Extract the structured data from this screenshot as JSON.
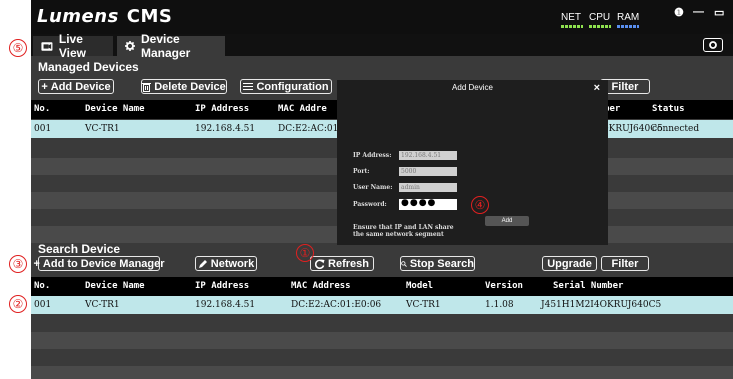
{
  "app": {
    "title_part1": "Lumens",
    "title_part2": "CMS",
    "meters": {
      "net": "NET",
      "cpu": "CPU",
      "ram": "RAM"
    },
    "win_info": "❶",
    "win_min": "—",
    "win_max": "▭"
  },
  "tabs": [
    {
      "label": "Live View",
      "icon": "video-icon"
    },
    {
      "label": "Device Manager",
      "icon": "gear-icon"
    }
  ],
  "managed": {
    "title": "Managed Devices",
    "buttons": {
      "add": "Add Device",
      "delete": "Delete Device",
      "config": "Configuration",
      "filter": "Filter"
    },
    "columns": {
      "no": "No.",
      "name": "Device Name",
      "ip": "IP Address",
      "mac": "MAC Addre",
      "serial": "l Number",
      "status": "Status"
    },
    "rows": [
      {
        "no": "001",
        "name": "VC-TR1",
        "ip": "192.168.4.51",
        "mac": "DC:E2:AC:01",
        "serial": "M2I4OKRUJ640C5",
        "status": "connected"
      }
    ]
  },
  "search": {
    "title": "Search Device",
    "buttons": {
      "add": "Add to Device Manager",
      "network": "Network",
      "refresh": "Refresh",
      "stop": "Stop Search",
      "upgrade": "Upgrade",
      "filter": "Filter"
    },
    "columns": {
      "no": "No.",
      "name": "Device Name",
      "ip": "IP Address",
      "mac": "MAC Address",
      "model": "Model",
      "version": "Version",
      "serial": "Serial Number"
    },
    "rows": [
      {
        "no": "001",
        "name": "VC-TR1",
        "ip": "192.168.4.51",
        "mac": "DC:E2:AC:01:E0:06",
        "model": "VC-TR1",
        "version": "1.1.08",
        "serial": "J451H1M2I4OKRUJ640C5"
      }
    ]
  },
  "dialog": {
    "title": "Add Device",
    "close": "×",
    "ip_label": "IP Address:",
    "ip_value": "192.168.4.51",
    "port_label": "Port:",
    "port_value": "5000",
    "user_label": "User Name:",
    "user_value": "admin",
    "password_label": "Password:",
    "password_value": "●●●●",
    "note_line1": "Ensure that IP and LAN share",
    "note_line2": "the same network segment",
    "add_button": "Add"
  },
  "callouts": [
    "⑤",
    "③",
    "②",
    "①",
    "④"
  ],
  "colors": {
    "accent_selected": "#bfe7ea",
    "callout": "#e02020",
    "panel": "#3a3a3a"
  }
}
